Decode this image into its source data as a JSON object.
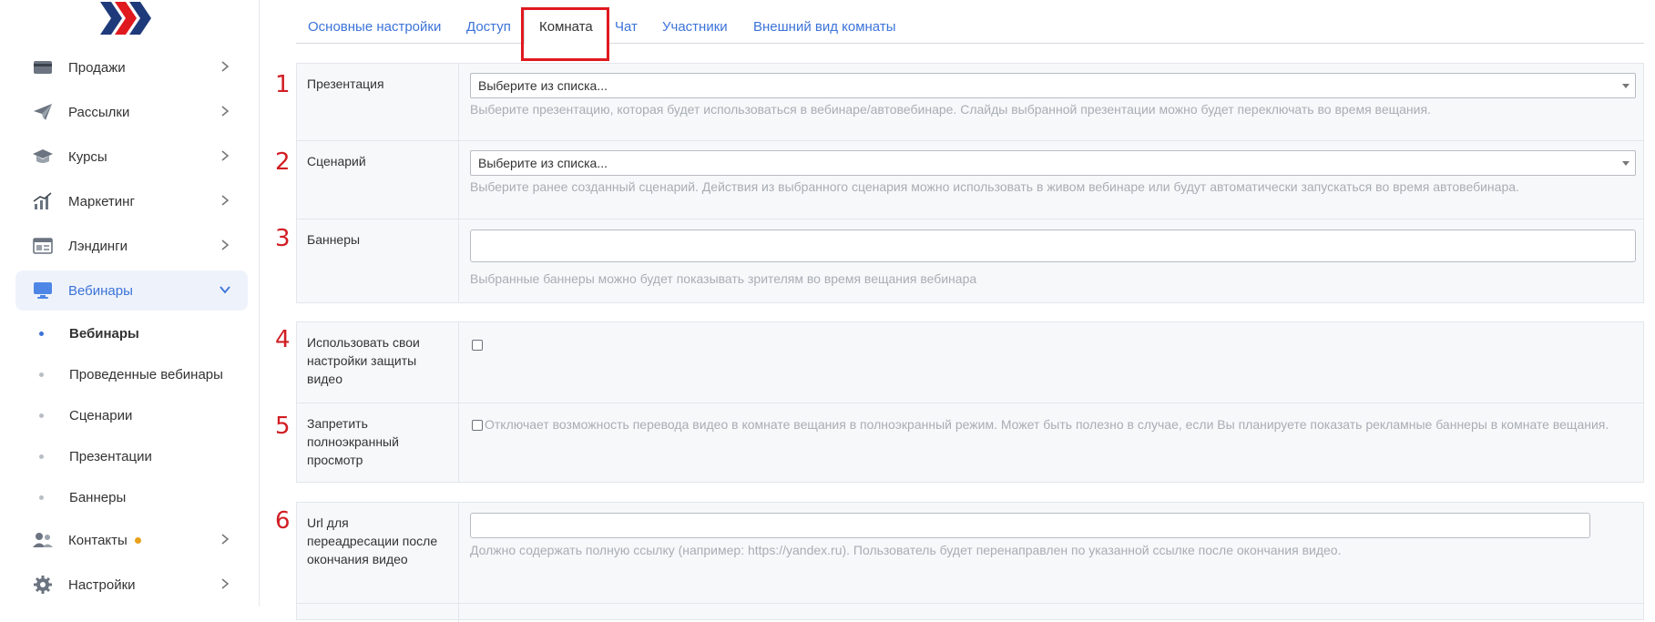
{
  "sidebar": {
    "items": [
      {
        "label": "Продажи",
        "icon": "card-icon"
      },
      {
        "label": "Рассылки",
        "icon": "paper-plane-icon"
      },
      {
        "label": "Курсы",
        "icon": "graduation-cap-icon"
      },
      {
        "label": "Маркетинг",
        "icon": "chart-icon"
      },
      {
        "label": "Лэндинги",
        "icon": "landing-page-icon"
      },
      {
        "label": "Вебинары",
        "icon": "monitor-icon"
      },
      {
        "label": "Контакты",
        "icon": "people-icon"
      },
      {
        "label": "Настройки",
        "icon": "gear-icon"
      }
    ],
    "sub_items": [
      {
        "label": "Вебинары"
      },
      {
        "label": "Проведенные вебинары"
      },
      {
        "label": "Сценарии"
      },
      {
        "label": "Презентации"
      },
      {
        "label": "Баннеры"
      }
    ]
  },
  "tabs": [
    {
      "label": "Основные настройки"
    },
    {
      "label": "Доступ"
    },
    {
      "label": "Комната"
    },
    {
      "label": "Чат"
    },
    {
      "label": "Участники"
    },
    {
      "label": "Внешний вид комнаты"
    }
  ],
  "annotations": [
    "1",
    "2",
    "3",
    "4",
    "5",
    "6"
  ],
  "form": {
    "presentation": {
      "label": "Презентация",
      "value": "Выберите из списка...",
      "help": "Выберите презентацию, которая будет использоваться в вебинаре/автовебинаре. Слайды выбранной презентации можно будет переключать во время вещания."
    },
    "scenario": {
      "label": "Сценарий",
      "value": "Выберите из списка...",
      "help": "Выберите ранее созданный сценарий. Действия из выбранного сценария можно использовать в живом вебинаре или будут автоматически запускаться во время автовебинара."
    },
    "banners": {
      "label": "Баннеры",
      "help": "Выбранные баннеры можно будет показывать зрителям во время вещания вебинара"
    },
    "protection": {
      "label": "Использовать свои настройки защиты видео"
    },
    "fullscreen": {
      "label": "Запретить полноэкранный просмотр",
      "help": "Отключает возможность перевода видео в комнате вещания в полноэкранный режим. Может быть полезно в случае, если Вы планируете показать рекламные баннеры в комнате вещания."
    },
    "redirect": {
      "label": "Url для переадресации после окончания видео",
      "help": "Должно содержать полную ссылку (например: https://yandex.ru). Пользователь будет перенаправлен по указанной ссылке после окончания видео."
    }
  },
  "colors": {
    "accent": "#3b73d9",
    "highlight": "#e0191f",
    "annotation": "#d11e24",
    "help_text": "#a8adb4"
  }
}
